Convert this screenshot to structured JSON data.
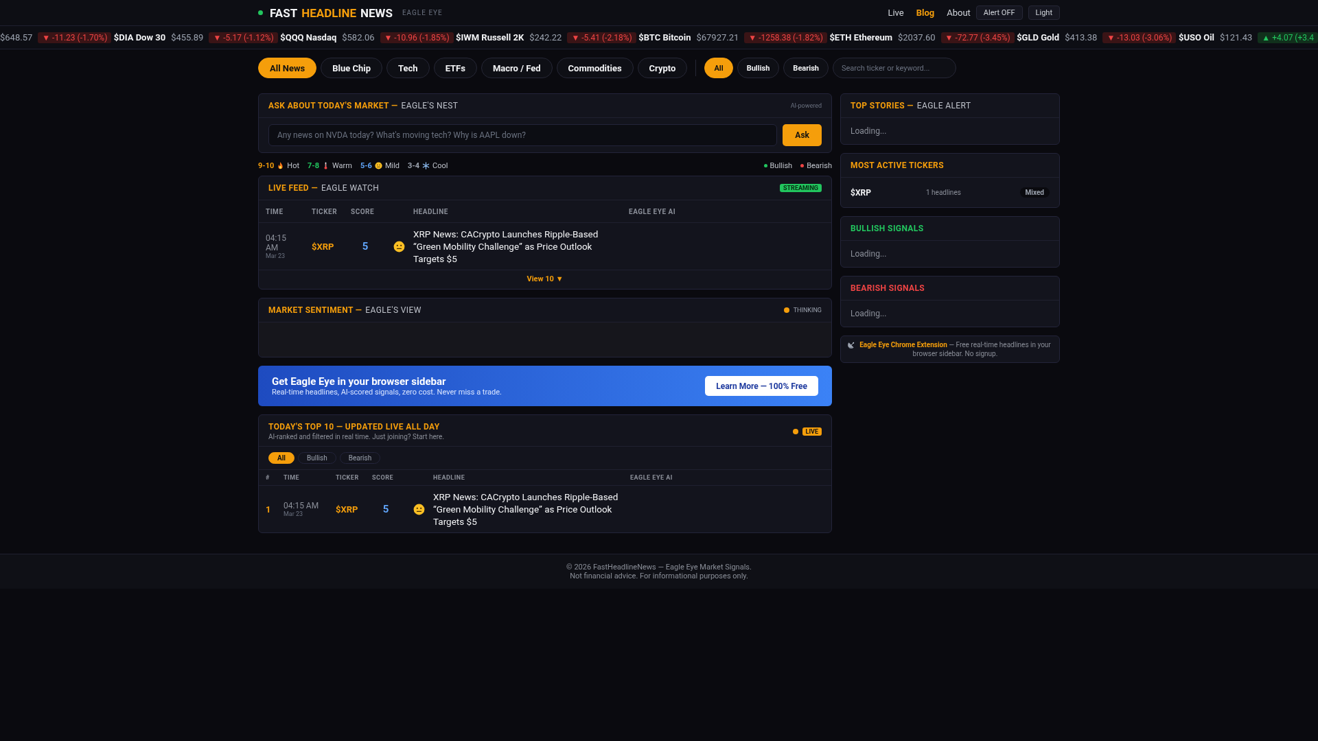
{
  "header": {
    "logo": [
      {
        "text": "FAST",
        "color": "#f3f4f6"
      },
      {
        "text": "HEADLINE",
        "color": "#f59e0b"
      },
      {
        "text": "NEWS",
        "color": "#f3f4f6"
      }
    ],
    "tagline": "EAGLE EYE",
    "nav": [
      {
        "label": "Live",
        "selected": false
      },
      {
        "label": "Blog",
        "selected": true
      },
      {
        "label": "About",
        "selected": false
      }
    ],
    "buttons": [
      "Alert OFF",
      "Light"
    ]
  },
  "ticker": [
    {
      "price": "$648.57",
      "change": "▼ -11.23 (-1.70%)",
      "kind": "down"
    },
    {
      "symbol": "$DIA Dow 30",
      "price": "$455.89",
      "change": "▼ -5.17 (-1.12%)",
      "kind": "down"
    },
    {
      "symbol": "$QQQ Nasdaq",
      "price": "$582.06",
      "change": "▼ -10.96 (-1.85%)",
      "kind": "down"
    },
    {
      "symbol": "$IWM Russell 2K",
      "price": "$242.22",
      "change": "▼ -5.41 (-2.18%)",
      "kind": "down"
    },
    {
      "symbol": "$BTC Bitcoin",
      "price": "$67927.21",
      "change": "▼ -1258.38 (-1.82%)",
      "kind": "down"
    },
    {
      "symbol": "$ETH Ethereum",
      "price": "$2037.60",
      "change": "▼ -72.77 (-3.45%)",
      "kind": "down"
    },
    {
      "symbol": "$GLD Gold",
      "price": "$413.38",
      "change": "▼ -13.03 (-3.06%)",
      "kind": "down"
    },
    {
      "symbol": "$USO Oil",
      "price": "$121.43",
      "change": "▲ +4.07 (+3.4",
      "kind": "up"
    }
  ],
  "categories": [
    {
      "label": "All News",
      "selected": true
    },
    {
      "label": "Blue Chip",
      "selected": false
    },
    {
      "label": "Tech",
      "selected": false
    },
    {
      "label": "ETFs",
      "selected": false
    },
    {
      "label": "Macro / Fed",
      "selected": false
    },
    {
      "label": "Commodities",
      "selected": false
    },
    {
      "label": "Crypto",
      "selected": false
    }
  ],
  "sentiment_filters": [
    {
      "label": "All",
      "selected": true
    },
    {
      "label": "Bullish",
      "selected": false
    },
    {
      "label": "Bearish",
      "selected": false
    }
  ],
  "search": {
    "placeholder": "Search ticker or keyword..."
  },
  "ask": {
    "title": "ASK ABOUT TODAY'S MARKET —",
    "subtitle": "EAGLE'S NEST",
    "note": "AI-powered",
    "placeholder": "Any news on NVDA today? What's moving tech? Why is AAPL down?",
    "button": "Ask"
  },
  "legend": [
    {
      "range": "9-10",
      "label": "Hot",
      "kind": "hot"
    },
    {
      "range": "7-8",
      "label": "Warm",
      "kind": "warm"
    },
    {
      "range": "5-6",
      "label": "Mild",
      "kind": "mild"
    },
    {
      "range": "3-4",
      "label": "Cool",
      "kind": "cool"
    }
  ],
  "legend_signals": [
    {
      "label": "Bullish",
      "color": "#22c55e"
    },
    {
      "label": "Bearish",
      "color": "#ef4444"
    }
  ],
  "live_feed": {
    "title": "LIVE FEED —",
    "subtitle": "EAGLE WATCH",
    "badge": "STREAMING",
    "columns": [
      "TIME",
      "TICKER",
      "SCORE",
      "HEADLINE",
      "EAGLE EYE AI"
    ],
    "rows": [
      {
        "time": "04:15 AM",
        "date": "Mar 23",
        "ticker": "$XRP",
        "score": "5",
        "color": "#60a5fa",
        "headline": "XRP News: CACrypto Launches Ripple-Based “Green Mobility Challenge” as Price Outlook Targets $5"
      }
    ],
    "more": "View 10 ▼"
  },
  "sentiment": {
    "title": "MARKET SENTIMENT —",
    "subtitle": "EAGLE'S VIEW",
    "status": "THINKING"
  },
  "promo": {
    "title": "Get Eagle Eye in your browser sidebar",
    "text": "Real-time headlines, AI-scored signals, zero cost. Never miss a trade.",
    "button": "Learn More — 100% Free"
  },
  "top10": {
    "title": "TODAY'S TOP 10 — UPDATED LIVE ALL DAY",
    "subtitle": "AI-ranked and filtered in real time. Just joining? Start here.",
    "badge": "LIVE",
    "filters": [
      {
        "label": "All",
        "selected": true
      },
      {
        "label": "Bullish",
        "selected": false
      },
      {
        "label": "Bearish",
        "selected": false
      }
    ],
    "columns": [
      "#",
      "TIME",
      "TICKER",
      "SCORE",
      "HEADLINE",
      "EAGLE EYE AI"
    ],
    "rows": [
      {
        "rank": "1",
        "time": "04:15 AM",
        "date": "Mar 23",
        "ticker": "$XRP",
        "score": "5",
        "color": "#60a5fa",
        "headline": "XRP News: CACrypto Launches Ripple-Based “Green Mobility Challenge” as Price Outlook Targets $5"
      }
    ]
  },
  "sidebar": [
    {
      "kind": "loading",
      "title": "TOP STORIES —",
      "subtitle": "EAGLE ALERT",
      "color": "#f59e0b",
      "text": "Loading..."
    },
    {
      "kind": "tickers",
      "title": "MOST ACTIVE TICKERS",
      "color": "#f59e0b",
      "items": [
        {
          "ticker": "$XRP",
          "count": "1 headlines",
          "sentiment": "Mixed"
        }
      ]
    },
    {
      "kind": "loading",
      "title": "BULLISH SIGNALS",
      "color": "#22c55e",
      "text": "Loading..."
    },
    {
      "kind": "loading",
      "title": "BEARISH SIGNALS",
      "color": "#ef4444",
      "text": "Loading..."
    }
  ],
  "extension": {
    "link": "Eagle Eye Chrome Extension",
    "text": "— Free real-time headlines in your browser sidebar. No signup."
  },
  "footer": [
    "© 2026 FastHeadlineNews — Eagle Eye Market Signals.",
    "Not financial advice. For informational purposes only."
  ]
}
